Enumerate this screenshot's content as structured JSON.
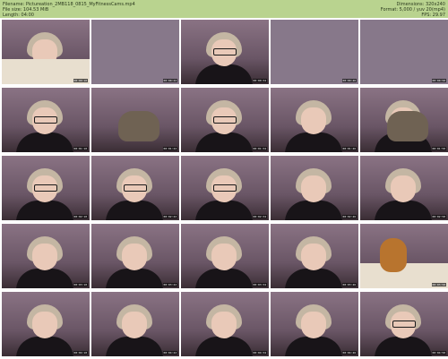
{
  "header": {
    "filename_line": "Filename: Pictureation_2MB118_0815_MyFitnessCams.mp4",
    "filesize_line": "File size: 104.53 MiB",
    "length_line": "Length: 04:00",
    "dimensions_line": "Dimensions: 320x240",
    "format_line": "Format: 5,000 / yuv 20(mp4)",
    "fps_line": "FPS: 29.97"
  },
  "thumbnails": [
    {
      "kind": "person-lying",
      "timestamp": "00:00:10"
    },
    {
      "kind": "empty-wall",
      "timestamp": "00:00:22"
    },
    {
      "kind": "person-glasses",
      "timestamp": "00:00:34"
    },
    {
      "kind": "empty-wall",
      "timestamp": "00:00:46"
    },
    {
      "kind": "empty-wall",
      "timestamp": "00:00:58"
    },
    {
      "kind": "person-glasses",
      "timestamp": "00:01:10"
    },
    {
      "kind": "cat",
      "timestamp": "00:01:22"
    },
    {
      "kind": "person-glasses",
      "timestamp": "00:01:34"
    },
    {
      "kind": "person",
      "timestamp": "00:01:46"
    },
    {
      "kind": "person-cat",
      "timestamp": "00:01:58"
    },
    {
      "kind": "person-glasses",
      "timestamp": "00:02:10"
    },
    {
      "kind": "person-glasses",
      "timestamp": "00:02:22"
    },
    {
      "kind": "person-glasses",
      "timestamp": "00:02:34"
    },
    {
      "kind": "person",
      "timestamp": "00:02:46"
    },
    {
      "kind": "person",
      "timestamp": "00:02:58"
    },
    {
      "kind": "person",
      "timestamp": "00:03:10"
    },
    {
      "kind": "person",
      "timestamp": "00:03:22"
    },
    {
      "kind": "person",
      "timestamp": "00:03:34"
    },
    {
      "kind": "person",
      "timestamp": "00:03:46"
    },
    {
      "kind": "teddy-bear",
      "timestamp": "00:03:58"
    },
    {
      "kind": "person",
      "timestamp": "00:04:10"
    },
    {
      "kind": "person",
      "timestamp": "00:04:22"
    },
    {
      "kind": "person",
      "timestamp": "00:04:34"
    },
    {
      "kind": "person",
      "timestamp": "00:04:46"
    },
    {
      "kind": "person-glasses",
      "timestamp": "00:04:58"
    }
  ],
  "colors": {
    "header_bg": "#b9d38f"
  }
}
